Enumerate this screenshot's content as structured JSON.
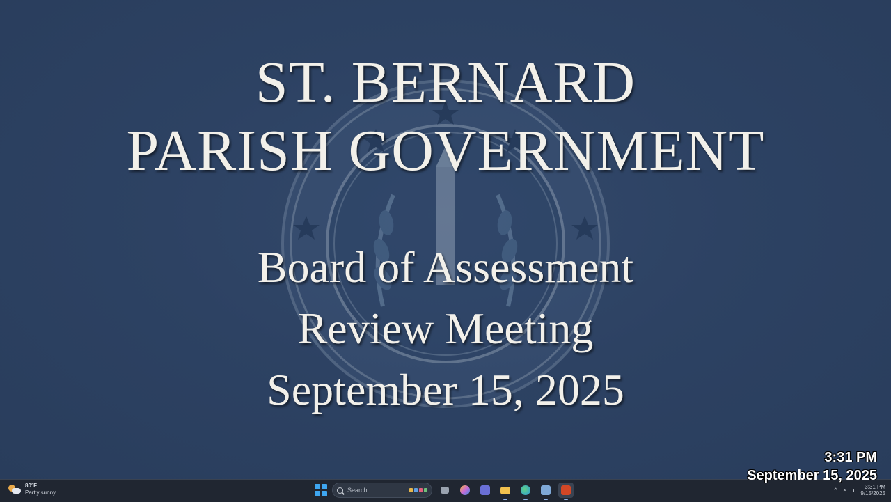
{
  "slide": {
    "title_lines": [
      "ST. BERNARD",
      "PARISH GOVERNMENT"
    ],
    "subtitle_lines": [
      "Board of Assessment",
      "Review Meeting",
      "September 15, 2025"
    ]
  },
  "overlay_clock": {
    "time": "3:31 PM",
    "date": "September 15, 2025"
  },
  "taskbar": {
    "weather": {
      "temp": "80°F",
      "condition": "Partly sunny",
      "icon": "partly-sunny-icon"
    },
    "search_placeholder": "Search",
    "apps": [
      {
        "name": "task-view",
        "color": "#9aa3b0"
      },
      {
        "name": "copilot",
        "color": "#c86bd6"
      },
      {
        "name": "teams",
        "color": "#6a6fd6"
      },
      {
        "name": "file-explorer",
        "color": "#f2c14e"
      },
      {
        "name": "edge",
        "color": "#2b9bd8"
      },
      {
        "name": "store",
        "color": "#7fa9d8"
      },
      {
        "name": "powerpoint",
        "color": "#d24726"
      }
    ],
    "tray_time": "3:31 PM",
    "tray_date": "9/15/2025"
  },
  "colors": {
    "background": "#2c4060",
    "text": "#f2f0ea",
    "taskbar": "#202631"
  }
}
